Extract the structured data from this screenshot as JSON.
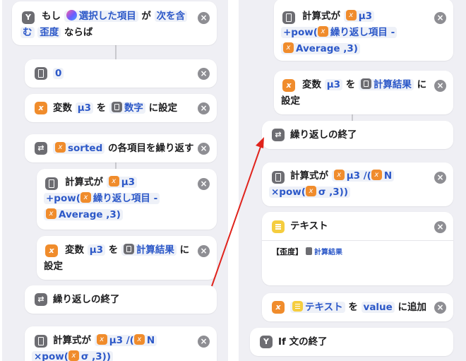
{
  "left": {
    "if_block": {
      "label_if": "もし",
      "subject": "選択した項目",
      "ga": "が",
      "cond_op_a": "次を含",
      "cond_op_b": "む",
      "cond_value": "歪度",
      "label_then": "ならば"
    },
    "number_block": {
      "value": "0"
    },
    "set_var_block": {
      "prefix": "変数",
      "var_name": "μ3",
      "wo": "を",
      "value": "数字",
      "suffix": "に設定"
    },
    "repeat_block": {
      "var": "sorted",
      "suffix": "の各項目を繰り返す"
    },
    "calc_block": {
      "label": "計算式が",
      "var": "μ3",
      "expr_a": "+pow(",
      "repeat_item": "繰り返し項目",
      "minus": " -",
      "avg": "Average",
      "expr_b": " ,3)"
    },
    "set_var2_block": {
      "prefix": "変数",
      "var_name": "μ3",
      "wo": "を",
      "value": "計算結果",
      "suffix": "に",
      "suffix2": "設定"
    },
    "end_repeat_block": {
      "label": "繰り返しの終了"
    },
    "calc2_block": {
      "label": "計算式が",
      "var": "μ3",
      "expr_a": " /(",
      "var_n": "N",
      "expr_b": "×pow(",
      "sigma": "σ",
      "expr_c": " ,3))"
    }
  },
  "right": {
    "calc_block": {
      "label": "計算式が",
      "var": "μ3",
      "expr_a": "+pow(",
      "repeat_item": "繰り返し項目",
      "minus": " -",
      "avg": "Average",
      "expr_b": " ,3)"
    },
    "set_var_block": {
      "prefix": "変数",
      "var_name": "μ3",
      "wo": "を",
      "value": "計算結果",
      "suffix": "に",
      "suffix2": "設定"
    },
    "end_repeat_block": {
      "label": "繰り返しの終了"
    },
    "calc2_block": {
      "label": "計算式が",
      "var": "μ3",
      "expr_a": " /(",
      "var_n": "N",
      "expr_b": "×pow(",
      "sigma": "σ",
      "expr_c": " ,3))"
    },
    "text_block": {
      "title": "テキスト",
      "body_prefix": "【歪度】",
      "body_token": "計算結果"
    },
    "add_block": {
      "token": "テキスト",
      "wo": "を",
      "value": "value",
      "suffix": "に追加"
    },
    "end_if_block": {
      "label": "If 文の終了"
    }
  },
  "colors": {
    "arrow": "#e0231c",
    "accent": "#2c58c8",
    "variable": "#f08c2c",
    "calc": "#6d6d72",
    "text": "#f5cd3e"
  }
}
